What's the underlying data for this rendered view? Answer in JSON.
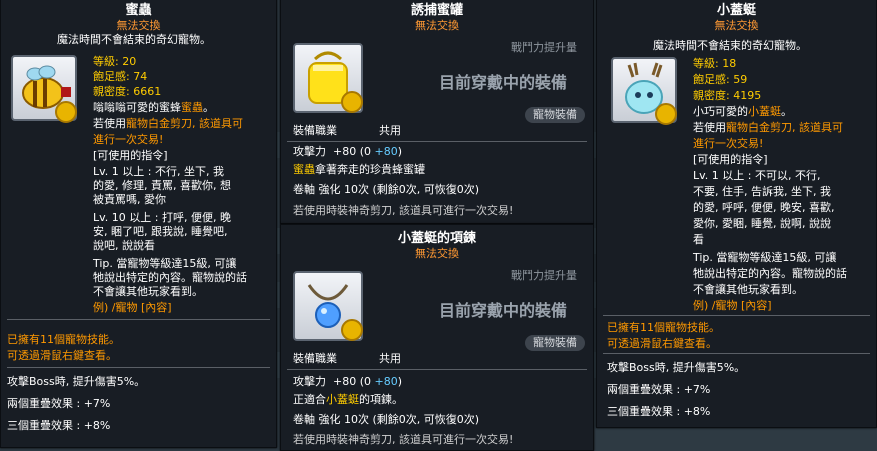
{
  "panel1": {
    "title": "蜜蟲",
    "trade": "無法交換",
    "desc": "魔法時間不會結束的奇幻寵物。",
    "level": "等級: 20",
    "fullness": "飽足感: 74",
    "closeness": "親密度: 6661",
    "line1": "嗡嗡嗡可愛的蜜蜂",
    "line1_name": "蜜蟲",
    "line1_end": "。",
    "line2a": "若使用",
    "line2b": "寵物白金剪刀",
    "line2c": ", 該道具可",
    "line3": "進行一次交易!",
    "cmd_header": "[可使用的指令]",
    "cmd": [
      "Lv. 1 以上 : 不行, 坐下, 我",
      "的愛, 修理, 責罵, 喜歡你, 想",
      "被責罵嗎, 愛你",
      "Lv. 10 以上 : 打呼, 便便, 晚",
      "安, 睏了吧, 跟我說, 睡覺吧,",
      "說吧, 說說看",
      "Tip. 當寵物等級達15級, 可讓",
      "牠說出特定的內容。寵物說的話",
      "不會讓其他玩家看到。",
      "例) /寵物 [內容]"
    ],
    "skills1": "已擁有11個寵物技能。",
    "skills2": "可透過滑鼠右鍵查看。",
    "boss": "攻擊Boss時, 提升傷害5%。",
    "set2": "兩個重疊效果 : +7%",
    "set3": "三個重疊效果 : +8%"
  },
  "panel2": {
    "title": "誘捕蜜罐",
    "trade": "無法交換",
    "fight_up": "戰鬥力提升量",
    "equipped": "目前穿戴中的裝備",
    "pet_equip": "寵物裝備",
    "job_label": "裝備職業",
    "job_value": "共用",
    "atk_label": "攻擊力",
    "atk_value": "+80 (0 ",
    "atk_bonus": "+80",
    "atk_close": ")",
    "note_name": "蜜蟲",
    "note_rest": "拿著奔走的珍貴蜂蜜罐",
    "scroll": "卷軸 強化 10次 (剩餘0次, 可恢復0次)",
    "scissors": "若使用時裝神奇剪刀, 該道具可進行一次交易!"
  },
  "panel3": {
    "title": "小蓋蜓的項鍊",
    "trade": "無法交換",
    "fight_up": "戰鬥力提升量",
    "equipped": "目前穿戴中的裝備",
    "pet_equip": "寵物裝備",
    "job_label": "裝備職業",
    "job_value": "共用",
    "atk_label": "攻擊力",
    "atk_value": "+80 (0 ",
    "atk_bonus": "+80",
    "atk_close": ")",
    "note_a": "正適合",
    "note_name": "小蓋蜓",
    "note_rest": "的項鍊。",
    "scroll": "卷軸 強化 10次 (剩餘0次, 可恢復0次)",
    "scissors": "若使用時裝神奇剪刀, 該道具可進行一次交易!"
  },
  "panel4": {
    "title": "小蓋蜓",
    "trade": "無法交換",
    "desc": "魔法時間不會結束的奇幻寵物。",
    "level": "等級: 18",
    "fullness": "飽足感: 59",
    "closeness": "親密度: 4195",
    "line1": "小巧可愛的",
    "line1_name": "小蓋蜓",
    "line1_end": "。",
    "line2a": "若使用",
    "line2b": "寵物白金剪刀",
    "line2c": ", 該道具可",
    "line3": "進行一次交易!",
    "cmd_header": "[可使用的指令]",
    "cmd": [
      "Lv. 1 以上 : 不可以, 不行,",
      "不要, 住手, 告訴我, 坐下, 我",
      "的愛, 呼呼, 便便, 晚安, 喜歡,",
      "愛你, 愛睏, 睡覺, 說啊, 說說",
      "看",
      "Tip. 當寵物等級達15級, 可讓",
      "牠說出特定的內容。寵物說的話",
      "不會讓其他玩家看到。",
      "例) /寵物 [內容]"
    ],
    "skills1": "已擁有11個寵物技能。",
    "skills2": "可透過滑鼠右鍵查看。",
    "boss": "攻擊Boss時, 提升傷害5%。",
    "set2": "兩個重疊效果 : +7%",
    "set3": "三個重疊效果 : +8%"
  }
}
